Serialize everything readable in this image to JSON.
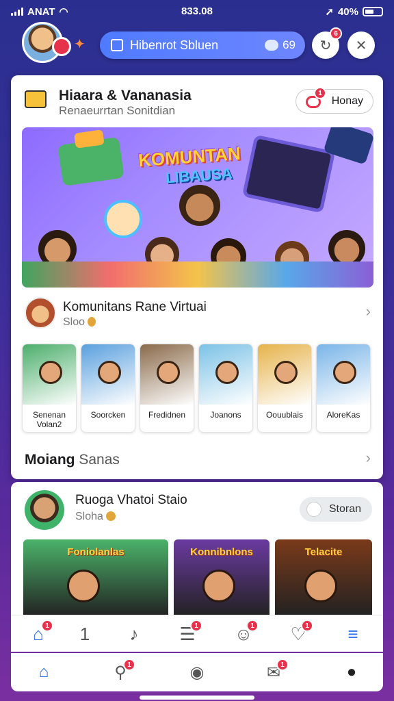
{
  "status_bar": {
    "carrier": "ANAT",
    "time": "833.08",
    "battery": "40%"
  },
  "header": {
    "search_placeholder": "Hibenrot Sbluen",
    "chat_count": "69",
    "notif_count": "6"
  },
  "card": {
    "title": "Hiaara & Vananasia",
    "subtitle": "Renaeurrtan Sonitdian",
    "button_label": "Honay",
    "button_badge": "1",
    "banner": {
      "title": "KOMUNTAN",
      "subtitle": "LIBAUSA"
    },
    "room": {
      "title": "Komunitans Rane Virtuai",
      "subtitle": "Sloo"
    },
    "tiles": [
      {
        "label": "Senenan\nVolan2",
        "color": "#4cae6b"
      },
      {
        "label": "Soorcken",
        "color": "#5aa0de"
      },
      {
        "label": "Fredidnen",
        "color": "#8a6a4a"
      },
      {
        "label": "Joanons",
        "color": "#7cc2e6"
      },
      {
        "label": "Oouublais",
        "color": "#e6b34c"
      },
      {
        "label": "AloreKas",
        "color": "#7ab5e8"
      }
    ],
    "section": {
      "title": "Moiang",
      "sub": "Sanas"
    }
  },
  "card2": {
    "title": "Ruoga Vhatoi Staio",
    "subtitle": "Sloha",
    "button_label": "Storan",
    "media": [
      {
        "label": "Foniolanlas",
        "color": "#4bb36a"
      },
      {
        "label": "Konnibnlons",
        "color": "#6a3aa0"
      },
      {
        "label": "Telacite",
        "color": "#7a3a1a"
      }
    ]
  },
  "nav1": [
    {
      "icon": "home-icon",
      "glyph": "⌂",
      "badge": "1",
      "color": "#2b6ee6"
    },
    {
      "icon": "one-icon",
      "glyph": "1",
      "badge": "",
      "color": "#555"
    },
    {
      "icon": "music-note-icon",
      "glyph": "♪",
      "badge": "",
      "color": "#555"
    },
    {
      "icon": "list-icon",
      "glyph": "☰",
      "badge": "1",
      "color": "#555"
    },
    {
      "icon": "profile-icon",
      "glyph": "☺",
      "badge": "1",
      "color": "#555"
    },
    {
      "icon": "heart-icon",
      "glyph": "♡",
      "badge": "1",
      "color": "#555"
    },
    {
      "icon": "menu-icon",
      "glyph": "≡",
      "badge": "",
      "color": "#2b6ee6"
    }
  ],
  "nav2": [
    {
      "icon": "home-icon",
      "glyph": "⌂",
      "badge": "",
      "color": "#2b6ee6"
    },
    {
      "icon": "search-icon",
      "glyph": "⚲",
      "badge": "1",
      "color": "#555"
    },
    {
      "icon": "record-icon",
      "glyph": "◉",
      "badge": "",
      "color": "#555"
    },
    {
      "icon": "message-icon",
      "glyph": "✉",
      "badge": "1",
      "color": "#555"
    },
    {
      "icon": "avatar-icon",
      "glyph": "●",
      "badge": "",
      "color": "#222"
    }
  ]
}
